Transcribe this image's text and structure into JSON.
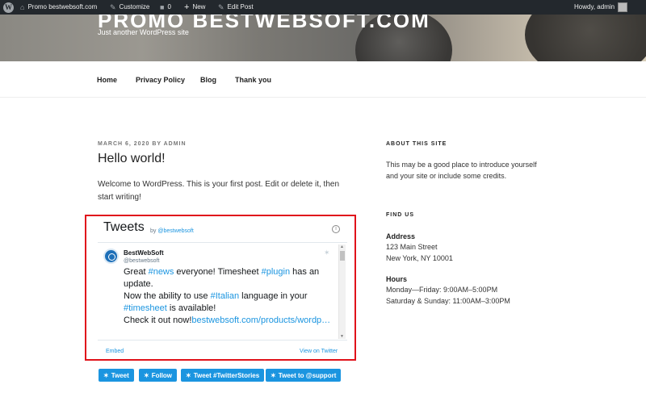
{
  "adminbar": {
    "site_name": "Promo bestwebsoft.com",
    "customize": "Customize",
    "comments_count": "0",
    "new": "New",
    "edit_post": "Edit Post",
    "howdy": "Howdy, admin"
  },
  "header": {
    "site_title": "PROMO BESTWEBSOFT.COM",
    "tagline": "Just another WordPress site"
  },
  "nav": {
    "items": [
      "Home",
      "Privacy Policy",
      "Blog",
      "Thank you"
    ]
  },
  "post": {
    "meta_date": "MARCH 6, 2020",
    "meta_by": "BY",
    "meta_author": "ADMIN",
    "title": "Hello world!",
    "body": "Welcome to WordPress. This is your first post. Edit or delete it, then start writing!"
  },
  "tweets": {
    "title": "Tweets",
    "by": "by",
    "by_handle": "@bestwebsoft",
    "tweet": {
      "name": "BestWebSoft",
      "handle": "@bestwebsoft",
      "t1": "Great ",
      "h1": "#news",
      "t2": " everyone! Timesheet ",
      "h2": "#plugin",
      "t3": " has an update.",
      "t4": "Now the ability to use ",
      "h3": "#Italian",
      "t5": " language in your",
      "h4": "#timesheet",
      "t6": " is available!",
      "t7": "Check it out now!",
      "link": "bestwebsoft.com/products/wordp…"
    },
    "embed": "Embed",
    "view": "View on Twitter"
  },
  "buttons": [
    "Tweet",
    "Follow",
    "Tweet #TwitterStories",
    "Tweet to @support"
  ],
  "sidebar": {
    "about_heading": "ABOUT THIS SITE",
    "about_text": "This may be a good place to introduce yourself and your site or include some credits.",
    "find_heading": "FIND US",
    "address_label": "Address",
    "address_line1": "123 Main Street",
    "address_line2": "New York, NY 10001",
    "hours_label": "Hours",
    "hours_line1": "Monday—Friday: 9:00AM–5:00PM",
    "hours_line2": "Saturday & Sunday: 11:00AM–3:00PM"
  },
  "colors": {
    "admin_bar": "#23282d",
    "twitter_blue": "#1b95e0",
    "highlight_red": "#e0121b"
  }
}
